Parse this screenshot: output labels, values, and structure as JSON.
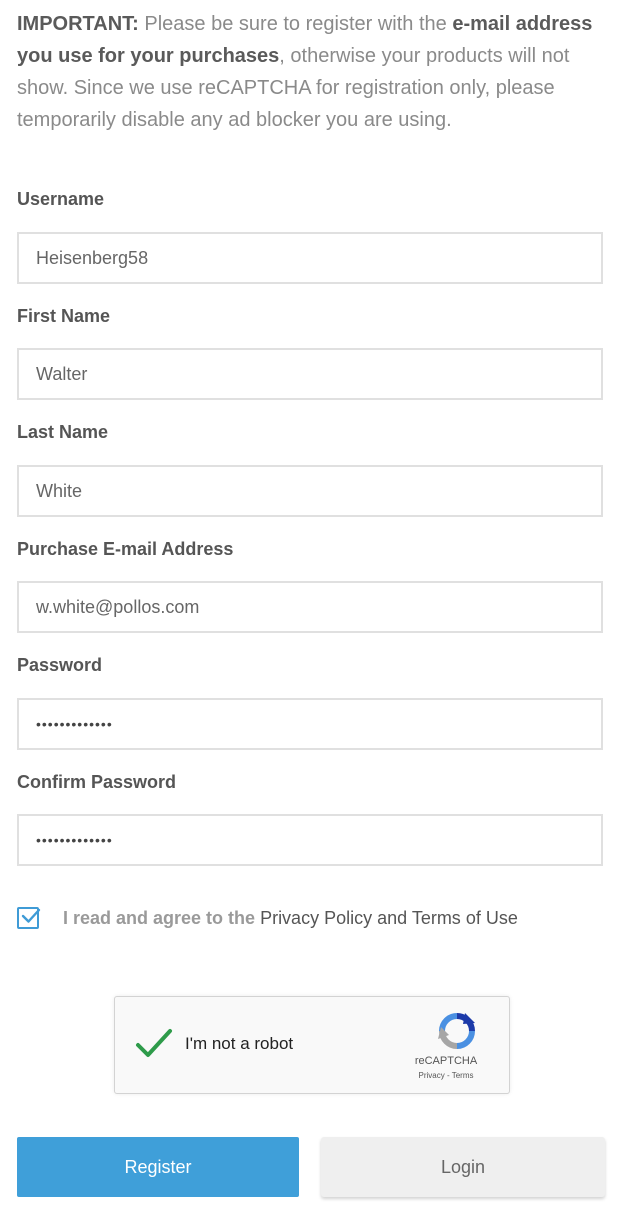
{
  "notice": {
    "important_label": "IMPORTANT:",
    "text_1": " Please be sure to register with the ",
    "emphasis": "e-mail address you use for your purchases",
    "text_2": ", otherwise your products will not show. Since we use reCAPTCHA for registration only, please temporarily disable any ad blocker you are using."
  },
  "form": {
    "username_label": "Username",
    "username_value": "Heisenberg58",
    "first_name_label": "First Name",
    "first_name_value": "Walter",
    "last_name_label": "Last Name",
    "last_name_value": "White",
    "email_label": "Purchase E-mail Address",
    "email_value": "w.white@pollos.com",
    "password_label": "Password",
    "password_value": "•••••••••••••",
    "confirm_label": "Confirm Password",
    "confirm_value": "•••••••••••••"
  },
  "agree": {
    "checked": true,
    "prefix": "I read and agree to the ",
    "privacy_link": "Privacy Policy",
    "and": " and ",
    "terms_link": "Terms of Use"
  },
  "captcha": {
    "label": "I'm not a robot",
    "brand": "reCAPTCHA",
    "links": "Privacy - Terms",
    "check_color": "#2e9b4a"
  },
  "buttons": {
    "register": "Register",
    "login": "Login"
  },
  "colors": {
    "accent": "#3f9fd9"
  }
}
